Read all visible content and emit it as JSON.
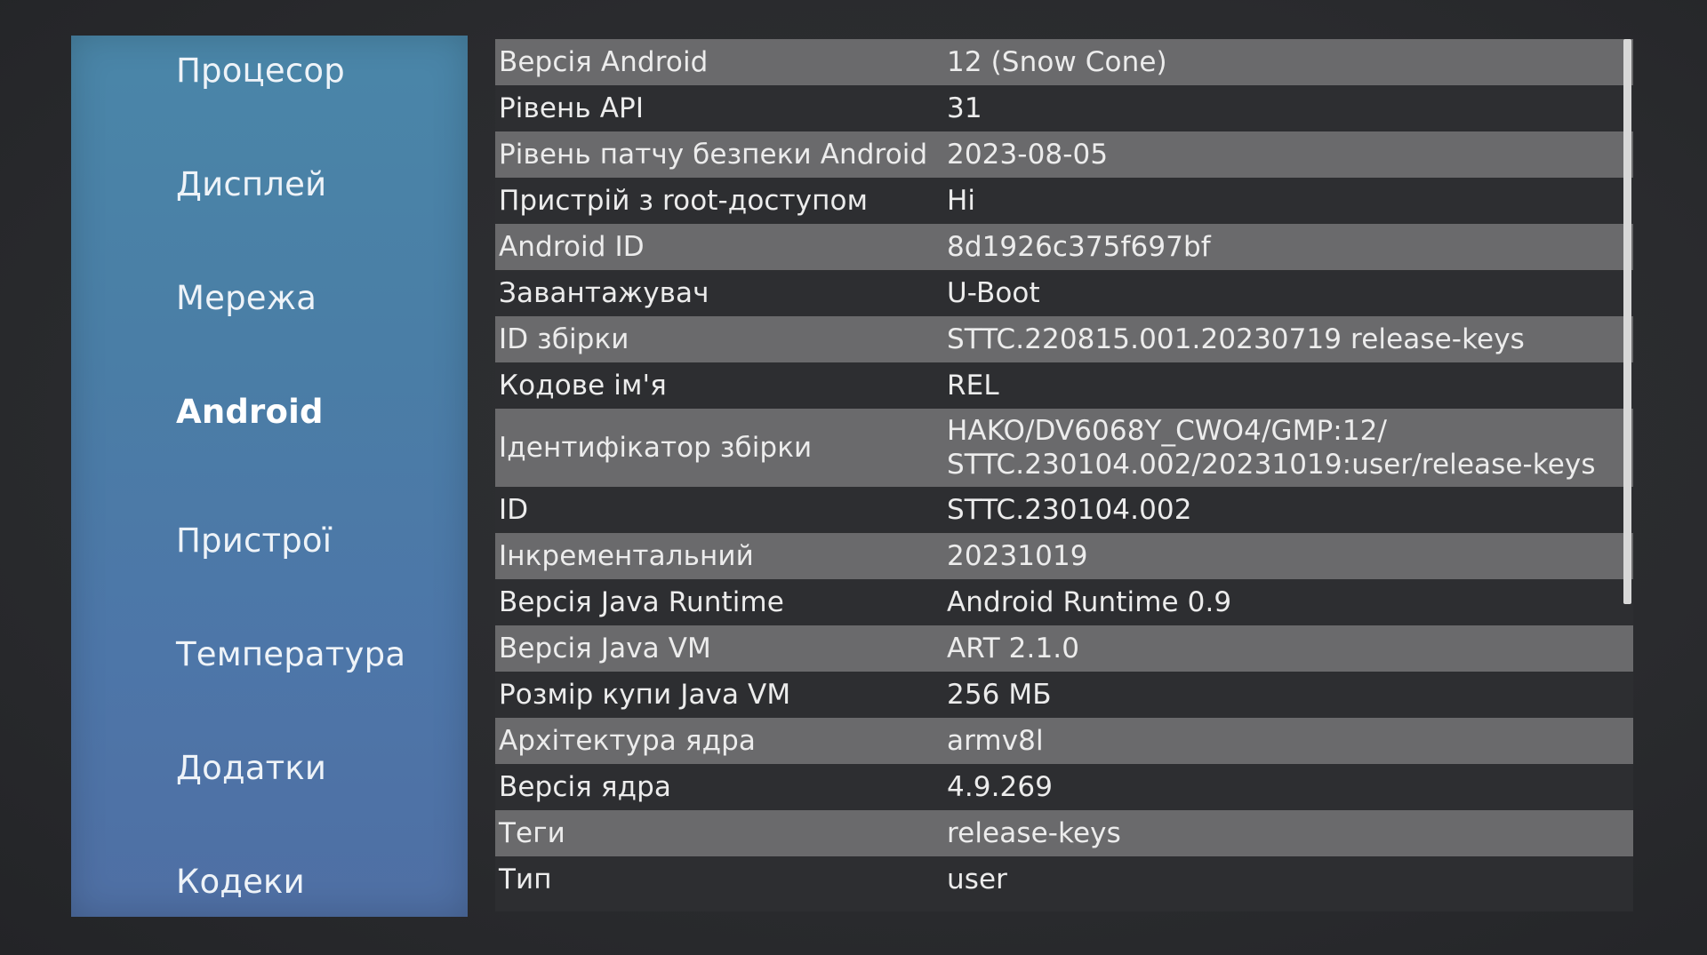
{
  "sidebar": {
    "items": [
      {
        "label": "Процесор",
        "active": false
      },
      {
        "label": "Дисплей",
        "active": false
      },
      {
        "label": "Мережа",
        "active": false
      },
      {
        "label": "Android",
        "active": true
      },
      {
        "label": "Пристрої",
        "active": false
      },
      {
        "label": "Температура",
        "active": false
      },
      {
        "label": "Додатки",
        "active": false
      },
      {
        "label": "Кодеки",
        "active": false
      }
    ]
  },
  "info": {
    "rows": [
      {
        "key": "Версія Android",
        "value": "12 (Snow Cone)"
      },
      {
        "key": "Рівень API",
        "value": "31"
      },
      {
        "key": "Рівень патчу безпеки Android",
        "value": "2023-08-05"
      },
      {
        "key": "Пристрій з root-доступом",
        "value": "Ні"
      },
      {
        "key": "Android ID",
        "value": "8d1926c375f697bf"
      },
      {
        "key": "Завантажувач",
        "value": "U-Boot"
      },
      {
        "key": "ID збірки",
        "value": "STTC.220815.001.20230719 release-keys"
      },
      {
        "key": "Кодове ім'я",
        "value": "REL"
      },
      {
        "key": "Ідентифікатор збірки",
        "value": "HAKO/DV6068Y_CWO4/GMP:12/ STTC.230104.002/20231019:user/release-keys"
      },
      {
        "key": "ID",
        "value": "STTC.230104.002"
      },
      {
        "key": "Інкрементальний",
        "value": "20231019"
      },
      {
        "key": "Версія Java Runtime",
        "value": "Android Runtime 0.9"
      },
      {
        "key": "Версія Java VM",
        "value": "ART 2.1.0"
      },
      {
        "key": "Розмір купи Java VM",
        "value": "256 МБ"
      },
      {
        "key": "Архітектура ядра",
        "value": "armv8l"
      },
      {
        "key": "Версія ядра",
        "value": "4.9.269"
      },
      {
        "key": "Теги",
        "value": "release-keys"
      },
      {
        "key": "Тип",
        "value": "user"
      }
    ]
  }
}
